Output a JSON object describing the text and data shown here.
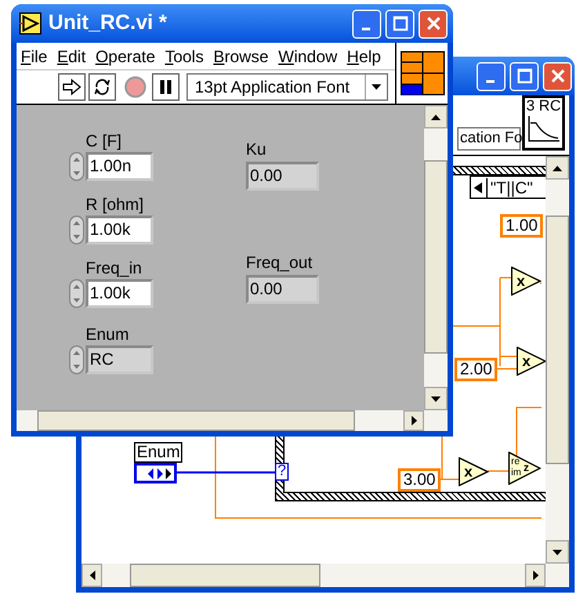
{
  "front_window": {
    "title": "Unit_RC.vi *",
    "menu": [
      "File",
      "Edit",
      "Operate",
      "Tools",
      "Browse",
      "Window",
      "Help"
    ],
    "font_selector": "13pt Application Font",
    "controls": [
      {
        "kind": "numeric",
        "label": "C [F]",
        "value": "1.00n"
      },
      {
        "kind": "numeric",
        "label": "R [ohm]",
        "value": "1.00k"
      },
      {
        "kind": "numeric",
        "label": "Freq_in",
        "value": "1.00k"
      },
      {
        "kind": "enum",
        "label": "Enum",
        "value": "RC"
      }
    ],
    "indicators": [
      {
        "label": "Ku",
        "value": "0.00"
      },
      {
        "label": "Freq_out",
        "value": "0.00"
      }
    ]
  },
  "back_window": {
    "font_selector": "cation Fo",
    "icon_text": "3 RC",
    "diagram": {
      "case_selector": "\"T||C\"",
      "constants": [
        "1.00",
        "2.00",
        "3.00"
      ],
      "nodes": [
        {
          "kind": "multiply",
          "symbol": "x"
        },
        {
          "kind": "multiply",
          "symbol": "x"
        },
        {
          "kind": "multiply",
          "symbol": "x"
        },
        {
          "kind": "complex",
          "labels": [
            "re",
            "im"
          ],
          "symbol": "z"
        }
      ],
      "enum_label": "Enum",
      "selector_terminal": "?"
    }
  }
}
